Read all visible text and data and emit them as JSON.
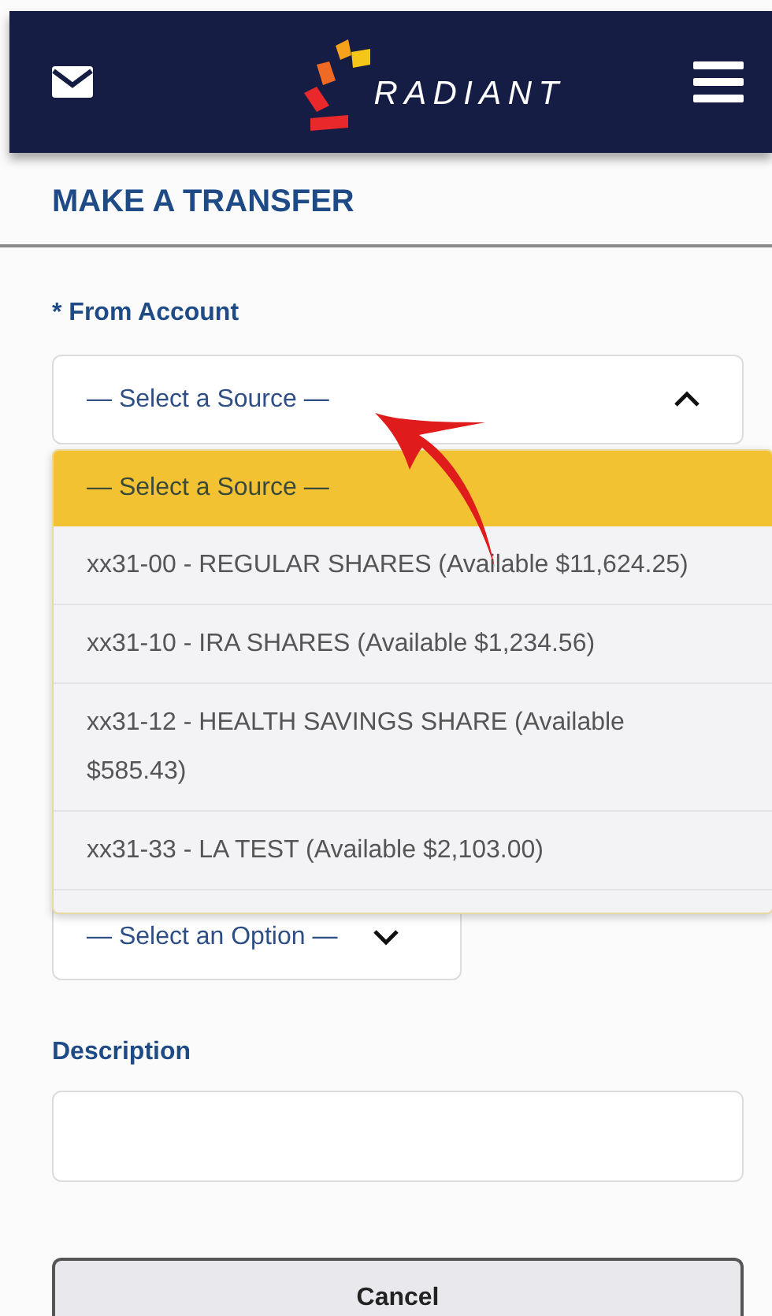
{
  "header": {
    "logo_text": "RADIANT"
  },
  "title": "MAKE A TRANSFER",
  "from_account": {
    "label": "* From Account",
    "value": "— Select a Source —",
    "expanded": true,
    "options": [
      {
        "label": "— Select a Source —",
        "selected": true
      },
      {
        "label": "xx31-00 - REGULAR SHARES (Available $11,624.25)",
        "selected": false
      },
      {
        "label": "xx31-10 - IRA SHARES (Available $1,234.56)",
        "selected": false
      },
      {
        "label": "xx31-12 - HEALTH SAVINGS SHARE (Available $585.43)",
        "selected": false
      },
      {
        "label": "xx31-33 - LA TEST (Available $2,103.00)",
        "selected": false
      }
    ]
  },
  "option_select": {
    "value": "— Select an Option —",
    "expanded": false
  },
  "description": {
    "label": "Description"
  },
  "buttons": [
    "Cancel"
  ]
}
